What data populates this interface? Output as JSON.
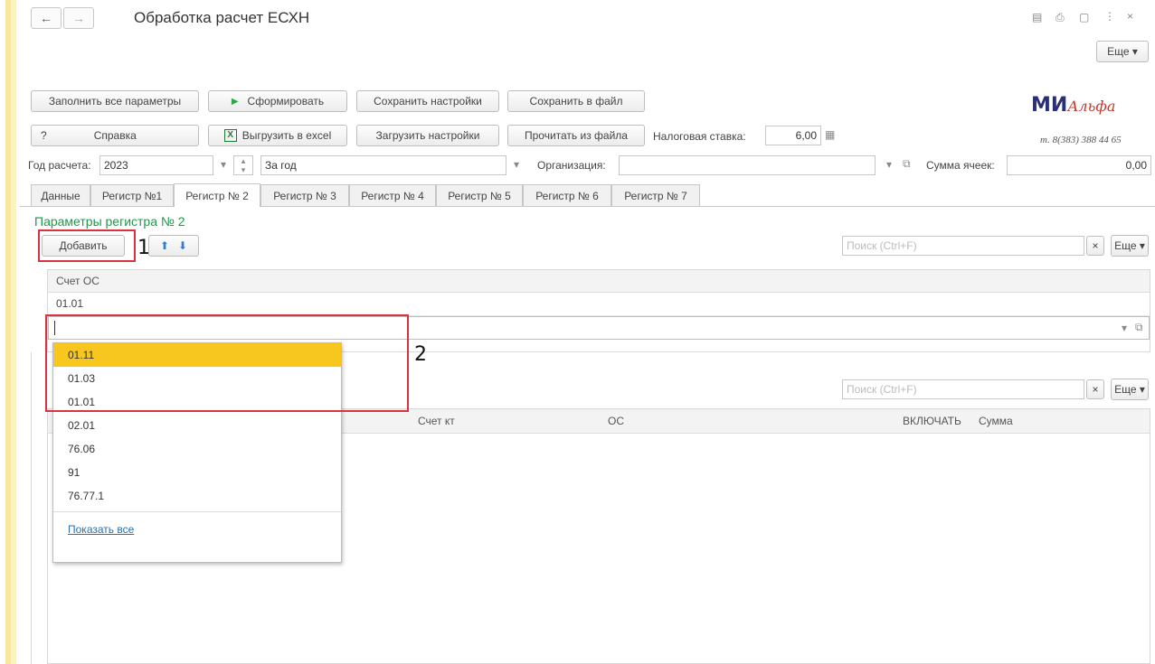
{
  "window": {
    "title": "Обработка расчет ЕСХН",
    "more_label": "Еще",
    "icons": [
      "back-icon",
      "forward-icon",
      "save-icon",
      "print-icon",
      "preview-icon",
      "menu-icon",
      "close-icon"
    ]
  },
  "toolbar": {
    "fill_all": "Заполнить все параметры",
    "generate": "Сформировать",
    "save_settings": "Сохранить настройки",
    "save_file": "Сохранить в файл",
    "help_q": "?",
    "help": "Справка",
    "export_excel": "Выгрузить в excel",
    "load_settings": "Загрузить настройки",
    "read_file": "Прочитать из файла",
    "tax_rate_label": "Налоговая ставка:",
    "tax_rate_value": "6,00"
  },
  "logo": {
    "text": "МИ",
    "script": "Альфа",
    "phone": "т. 8(383) 388 44 65"
  },
  "filters": {
    "year_label": "Год расчета:",
    "year_value": "2023",
    "period_value": "За год",
    "org_label": "Организация:",
    "org_value": "",
    "sum_label": "Сумма ячеек:",
    "sum_value": "0,00"
  },
  "tabs": [
    "Данные",
    "Регистр №1",
    "Регистр № 2",
    "Регистр № 3",
    "Регистр № 4",
    "Регистр № 5",
    "Регистр № 6",
    "Регистр № 7"
  ],
  "active_tab": 2,
  "section": {
    "title": "Параметры регистра № 2",
    "add_button": "Добавить",
    "search_placeholder": "Поиск (Ctrl+F)",
    "more_label": "Еще"
  },
  "grid1": {
    "header": "Счет ОС",
    "rows": [
      "01.01"
    ],
    "edit_value": ""
  },
  "dropdown": {
    "items": [
      "01.11",
      "01.03",
      "01.01",
      "02.01",
      "76.06",
      "91",
      "76.77.1"
    ],
    "selected": 0,
    "show_all": "Показать все"
  },
  "grid2": {
    "search_placeholder": "Поиск (Ctrl+F)",
    "more_label": "Еще",
    "columns": [
      "Счет кт",
      "ОС",
      "ВКЛЮЧАТЬ",
      "Сумма"
    ]
  },
  "annotations": [
    "1",
    "2"
  ],
  "colors": {
    "accent_yellow": "#f7c61f",
    "annotation_red": "#d9333f",
    "link_green": "#1a9a4a",
    "link_blue": "#2a6fb0"
  }
}
